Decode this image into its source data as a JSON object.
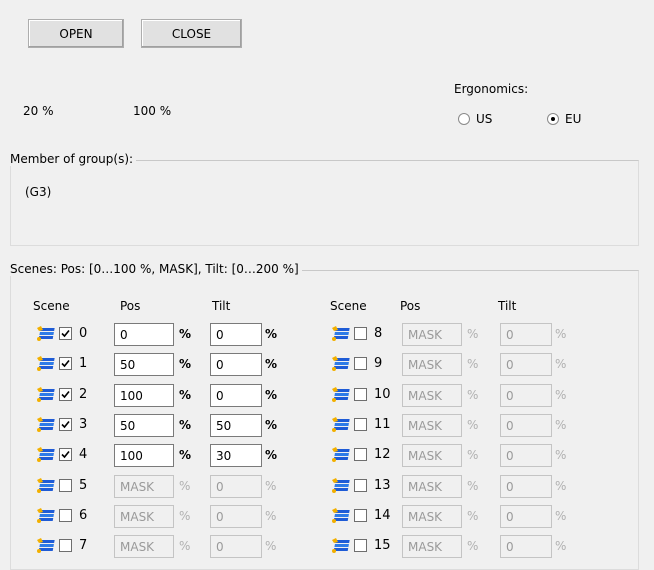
{
  "buttons": {
    "open": "OPEN",
    "close": "CLOSE"
  },
  "levels": {
    "left": "20 %",
    "right": "100 %"
  },
  "ergonomics": {
    "label": "Ergonomics:",
    "options": [
      "US",
      "EU"
    ],
    "selected": "EU"
  },
  "membership": {
    "title": "Member of group(s):",
    "value": "(G3)"
  },
  "scenes": {
    "title": "Scenes: Pos: [0…100 %, MASK], Tilt: [0…200 %]",
    "headers": {
      "scene": "Scene",
      "pos": "Pos",
      "tilt": "Tilt"
    },
    "unit": "%",
    "rows": [
      {
        "num": "0",
        "checked": true,
        "pos": "0",
        "tilt": "0"
      },
      {
        "num": "1",
        "checked": true,
        "pos": "50",
        "tilt": "0"
      },
      {
        "num": "2",
        "checked": true,
        "pos": "100",
        "tilt": "0"
      },
      {
        "num": "3",
        "checked": true,
        "pos": "50",
        "tilt": "50"
      },
      {
        "num": "4",
        "checked": true,
        "pos": "100",
        "tilt": "30"
      },
      {
        "num": "5",
        "checked": false,
        "pos": "MASK",
        "tilt": "0"
      },
      {
        "num": "6",
        "checked": false,
        "pos": "MASK",
        "tilt": "0"
      },
      {
        "num": "7",
        "checked": false,
        "pos": "MASK",
        "tilt": "0"
      },
      {
        "num": "8",
        "checked": false,
        "pos": "MASK",
        "tilt": "0"
      },
      {
        "num": "9",
        "checked": false,
        "pos": "MASK",
        "tilt": "0"
      },
      {
        "num": "10",
        "checked": false,
        "pos": "MASK",
        "tilt": "0"
      },
      {
        "num": "11",
        "checked": false,
        "pos": "MASK",
        "tilt": "0"
      },
      {
        "num": "12",
        "checked": false,
        "pos": "MASK",
        "tilt": "0"
      },
      {
        "num": "13",
        "checked": false,
        "pos": "MASK",
        "tilt": "0"
      },
      {
        "num": "14",
        "checked": false,
        "pos": "MASK",
        "tilt": "0"
      },
      {
        "num": "15",
        "checked": false,
        "pos": "MASK",
        "tilt": "0"
      }
    ]
  },
  "icons": {
    "scene": "scene-blind-icon"
  },
  "colors": {
    "checkbox_mark": "#000000",
    "disabled_text": "#9a9a9a"
  }
}
